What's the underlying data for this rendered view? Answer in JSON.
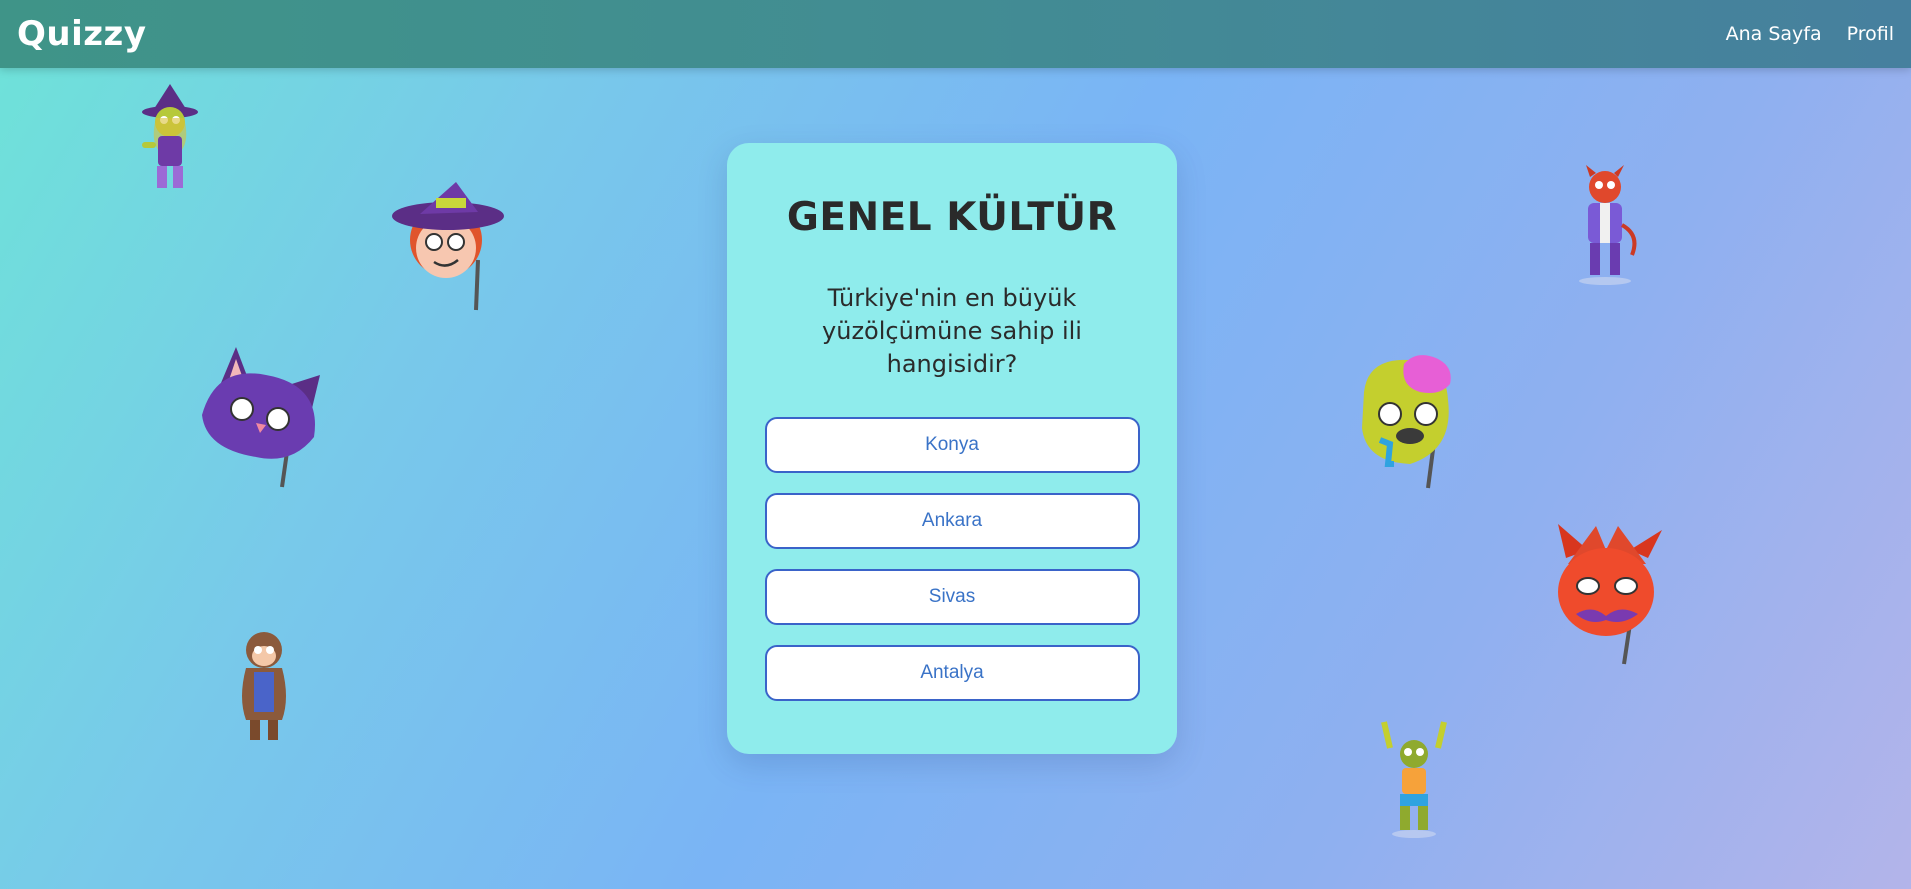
{
  "navbar": {
    "brand": "Quizzy",
    "links": [
      {
        "label": "Ana Sayfa"
      },
      {
        "label": "Profil"
      }
    ]
  },
  "quiz": {
    "title": "GENEL KÜLTÜR",
    "question": "Türkiye'nin en büyük yüzölçümüne sahip ili hangisidir?",
    "answers": [
      {
        "label": "Konya"
      },
      {
        "label": "Ankara"
      },
      {
        "label": "Sivas"
      },
      {
        "label": "Antalya"
      }
    ]
  },
  "decorations": [
    {
      "icon": "witch-character-sticker"
    },
    {
      "icon": "witch-mask-sticker"
    },
    {
      "icon": "cat-mask-sticker"
    },
    {
      "icon": "werewolf-character-sticker"
    },
    {
      "icon": "devil-character-sticker"
    },
    {
      "icon": "zombie-mask-sticker"
    },
    {
      "icon": "devil-mask-sticker"
    },
    {
      "icon": "zombie-character-sticker"
    }
  ],
  "colors": {
    "navbar_start": "#3f9488",
    "navbar_end": "#46809e",
    "card_background": "#8fecec",
    "button_border": "#3a63c9",
    "button_text": "#3a73c7"
  }
}
